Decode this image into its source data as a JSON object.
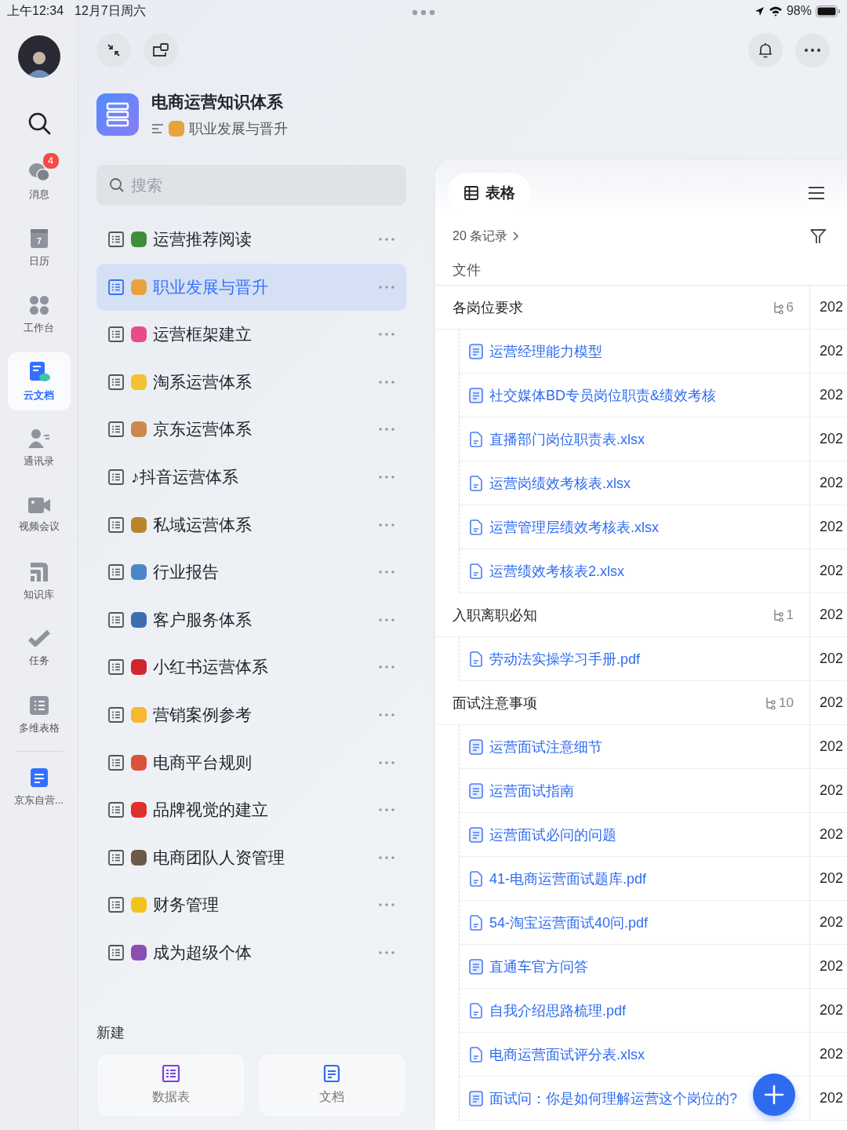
{
  "status_bar": {
    "time": "上午12:34",
    "date": "12月7日周六",
    "battery": "98%"
  },
  "rail": {
    "items": [
      {
        "kind": "messages",
        "label": "消息",
        "badge": "4",
        "selected": false
      },
      {
        "kind": "calendar",
        "label": "日历",
        "day": "7",
        "selected": false
      },
      {
        "kind": "workspace",
        "label": "工作台",
        "selected": false
      },
      {
        "kind": "docs",
        "label": "云文档",
        "selected": true
      },
      {
        "kind": "contacts",
        "label": "通讯录",
        "selected": false
      },
      {
        "kind": "video",
        "label": "视频会议",
        "selected": false
      },
      {
        "kind": "wiki",
        "label": "知识库",
        "selected": false
      },
      {
        "kind": "tasks",
        "label": "任务",
        "selected": false
      },
      {
        "kind": "base",
        "label": "多维表格",
        "selected": false
      }
    ],
    "pinned": [
      {
        "label": "京东自营...",
        "selected": false
      }
    ]
  },
  "space": {
    "title": "电商运营知识体系",
    "breadcrumb": {
      "text": "职业发展与晋升",
      "color": "#e8a33c"
    }
  },
  "search": {
    "placeholder": "搜索"
  },
  "nav": [
    {
      "name": "运营推荐阅读",
      "color": "#3d8f3a",
      "selected": false
    },
    {
      "name": "职业发展与晋升",
      "color": "#e8a33c",
      "selected": true
    },
    {
      "name": "运营框架建立",
      "color": "#e94b8a",
      "selected": false
    },
    {
      "name": "淘系运营体系",
      "color": "#f2c230",
      "selected": false
    },
    {
      "name": "京东运营体系",
      "color": "#c98a4b",
      "selected": false
    },
    {
      "name": "♪抖音运营体系",
      "selected": false
    },
    {
      "name": "私域运营体系",
      "color": "#b8862a",
      "selected": false
    },
    {
      "name": "行业报告",
      "color": "#4a86c8",
      "selected": false
    },
    {
      "name": "客户服务体系",
      "color": "#3b6fb0",
      "selected": false
    },
    {
      "name": "小红书运营体系",
      "color": "#d0262e",
      "selected": false
    },
    {
      "name": "营销案例参考",
      "color": "#f5b82e",
      "selected": false
    },
    {
      "name": "电商平台规则",
      "color": "#d9533a",
      "selected": false
    },
    {
      "name": "品牌视觉的建立",
      "color": "#e0302c",
      "selected": false
    },
    {
      "name": "电商团队人资管理",
      "color": "#6b5a4a",
      "selected": false
    },
    {
      "name": "财务管理",
      "color": "#f0c419",
      "selected": false
    },
    {
      "name": "成为超级个体",
      "color": "#8a4fb0",
      "selected": false
    }
  ],
  "create": {
    "label": "新建",
    "options": [
      {
        "kind": "sheet",
        "label": "数据表"
      },
      {
        "kind": "doc",
        "label": "文档"
      }
    ]
  },
  "table": {
    "view": "表格",
    "records": "20 条记录",
    "column": "文件",
    "groups": [
      {
        "name": "各岗位要求",
        "count": "6",
        "date": "202",
        "children": [
          {
            "name": "运营经理能力模型",
            "kind": "doc",
            "date": "202"
          },
          {
            "name": "社交媒体BD专员岗位职责&绩效考核",
            "kind": "doc",
            "date": "202"
          },
          {
            "name": "直播部门岗位职责表.xlsx",
            "kind": "file",
            "date": "202"
          },
          {
            "name": "运营岗绩效考核表.xlsx",
            "kind": "file",
            "date": "202"
          },
          {
            "name": "运营管理层绩效考核表.xlsx",
            "kind": "file",
            "date": "202"
          },
          {
            "name": "运营绩效考核表2.xlsx",
            "kind": "file",
            "date": "202"
          }
        ]
      },
      {
        "name": "入职离职必知",
        "count": "1",
        "date": "202",
        "children": [
          {
            "name": "劳动法实操学习手册.pdf",
            "kind": "file",
            "date": "202"
          }
        ]
      },
      {
        "name": "面试注意事项",
        "count": "10",
        "date": "202",
        "children": [
          {
            "name": "运营面试注意细节",
            "kind": "doc",
            "date": "202"
          },
          {
            "name": "运营面试指南",
            "kind": "doc",
            "date": "202"
          },
          {
            "name": "运营面试必问的问题",
            "kind": "doc",
            "date": "202"
          },
          {
            "name": "41-电商运营面试题库.pdf",
            "kind": "file",
            "date": "202"
          },
          {
            "name": "54-淘宝运营面试40问.pdf",
            "kind": "file",
            "date": "202"
          },
          {
            "name": "直通车官方问答",
            "kind": "doc",
            "date": "202"
          },
          {
            "name": "自我介绍思路梳理.pdf",
            "kind": "file",
            "date": "202"
          },
          {
            "name": "电商运营面试评分表.xlsx",
            "kind": "file",
            "date": "202"
          },
          {
            "name": "面试问：你是如何理解运营这个岗位的?",
            "kind": "doc",
            "date": "202"
          }
        ]
      }
    ]
  }
}
